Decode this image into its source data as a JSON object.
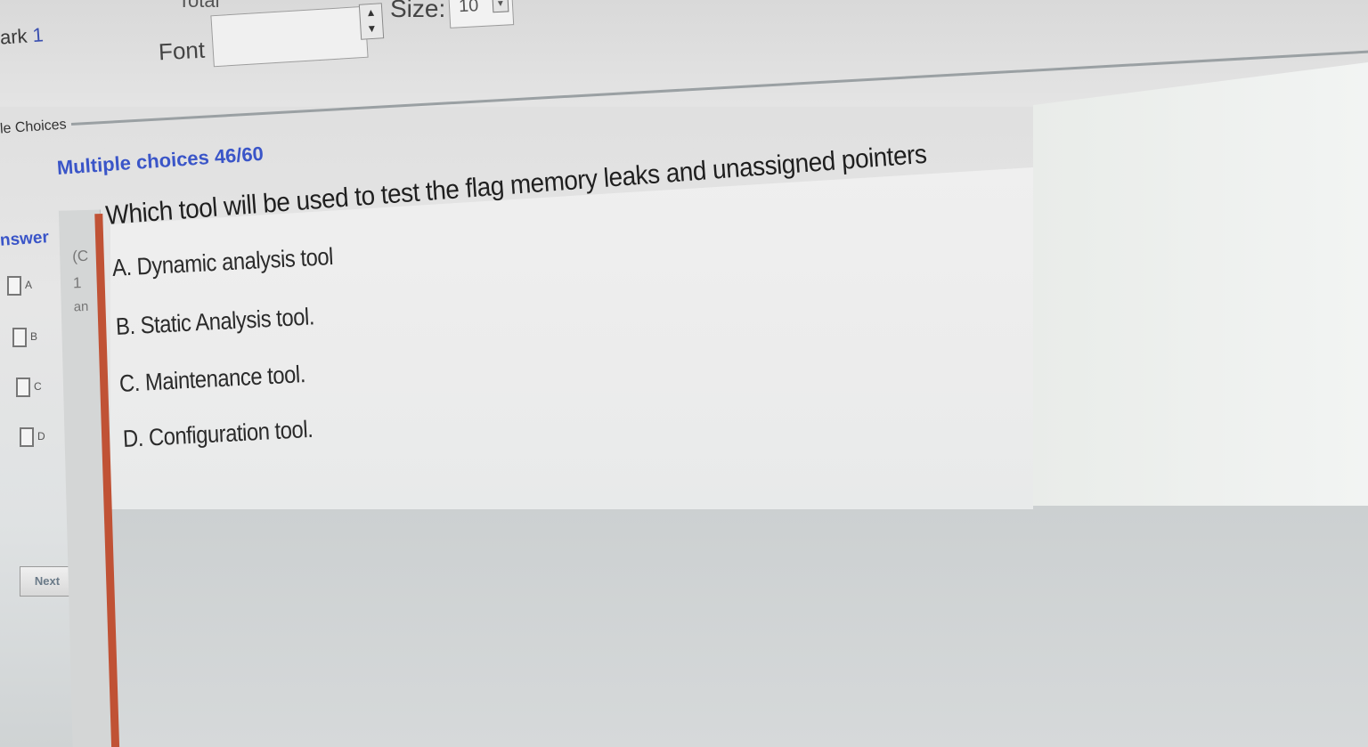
{
  "toolbar": {
    "mark_label": "ark",
    "mark_value": "1",
    "total_label": "Total",
    "font_label": "Font",
    "font_value": "",
    "size_label": "Size:",
    "size_value": "10"
  },
  "left_panel": {
    "choices_tab": "le Choices",
    "answer_title": "nswer",
    "options": [
      "A",
      "B",
      "C",
      "D"
    ],
    "next_label": "Next"
  },
  "section": {
    "title": "Multiple choices 46/60"
  },
  "side_strip": {
    "line1": "(C",
    "line2": "1",
    "line3": "an"
  },
  "question": {
    "text": "Which tool will be used to test the flag memory leaks and unassigned pointers",
    "options": [
      "A. Dynamic analysis tool",
      "B. Static Analysis tool.",
      "C. Maintenance tool.",
      "D. Configuration tool."
    ]
  }
}
